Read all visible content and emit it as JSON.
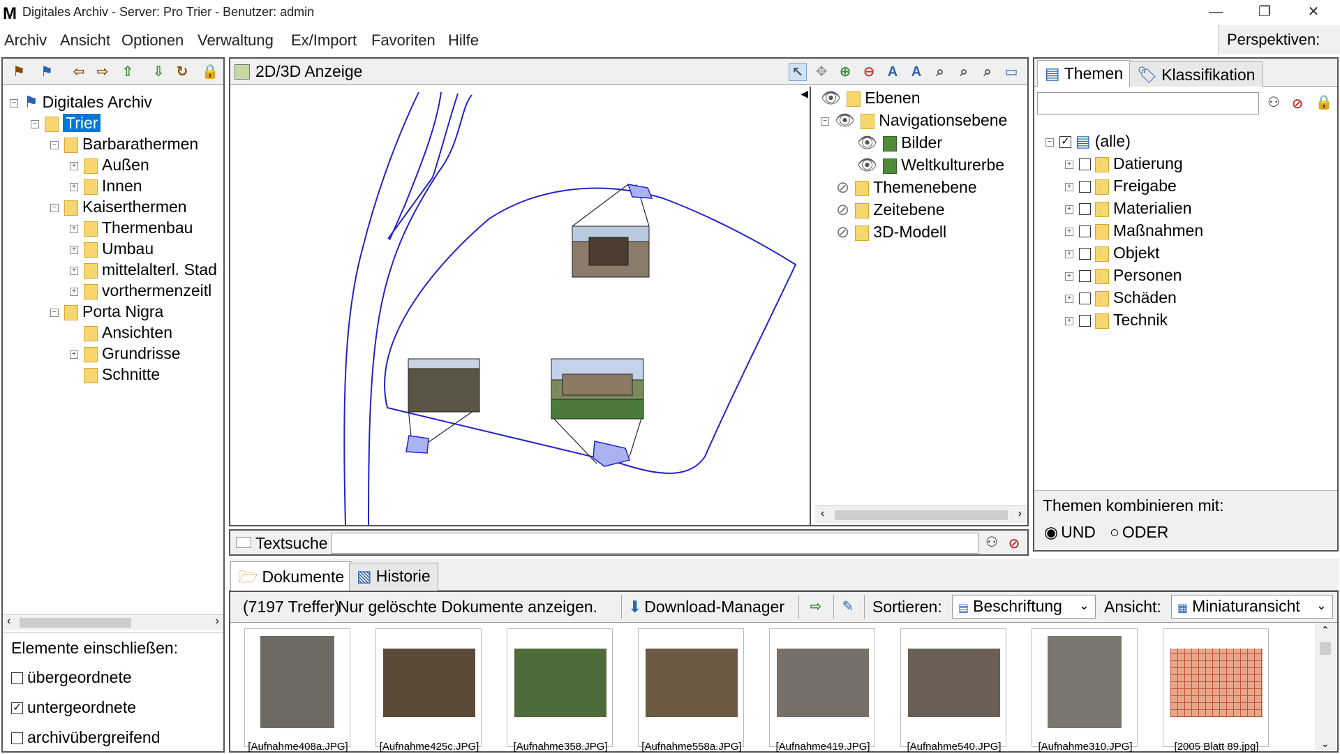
{
  "window": {
    "title": "Digitales Archiv - Server: Pro Trier - Benutzer: admin",
    "app_icon": "M",
    "min_icon": "minimize-icon",
    "restore_icon": "restore-icon",
    "close_icon": "close-icon"
  },
  "menu": {
    "items": [
      "Archiv",
      "Ansicht",
      "Optionen",
      "Verwaltung",
      "Ex/Import",
      "Favoriten",
      "Hilfe"
    ],
    "perspektiven": "Perspektiven:"
  },
  "left_tree": {
    "root": "Digitales Archiv",
    "nodes": [
      {
        "label": "Trier"
      },
      {
        "label": "Barbarathermen"
      },
      {
        "label": "Außen"
      },
      {
        "label": "Innen"
      },
      {
        "label": "Kaiserthermen"
      },
      {
        "label": "Thermenbau"
      },
      {
        "label": "Umbau"
      },
      {
        "label": "mittelalterl. Stad"
      },
      {
        "label": "vorthermenzeitl"
      },
      {
        "label": "Porta Nigra"
      },
      {
        "label": "Ansichten"
      },
      {
        "label": "Grundrisse"
      },
      {
        "label": "Schnitte"
      }
    ],
    "include_title": "Elemente einschließen:",
    "include_options": [
      {
        "label": "übergeordnete",
        "checked": false
      },
      {
        "label": "untergeordnete",
        "checked": true
      },
      {
        "label": "archivübergreifend",
        "checked": false
      }
    ]
  },
  "viewer": {
    "title": "2D/3D Anzeige",
    "layers": {
      "ebenen": "Ebenen",
      "navigation": "Navigationsebene",
      "bilder": "Bilder",
      "welt": "Weltkulturerbe",
      "themen": "Themenebene",
      "zeit": "Zeitebene",
      "modell": "3D-Modell"
    }
  },
  "themes": {
    "tab_themen": "Themen",
    "tab_klass": "Klassifikation",
    "root": "(alle)",
    "items": [
      "Datierung",
      "Freigabe",
      "Materialien",
      "Maßnahmen",
      "Objekt",
      "Personen",
      "Schäden",
      "Technik"
    ],
    "combine_label": "Themen kombinieren mit:",
    "und": "UND",
    "oder": "ODER"
  },
  "textsearch": {
    "label": "Textsuche"
  },
  "docs": {
    "tab_docs": "Dokumente",
    "tab_hist": "Historie",
    "hits": "(7197 Treffer)",
    "deleted": "Nur gelöschte Dokumente anzeigen.",
    "download": "Download-Manager",
    "sort_label": "Sortieren:",
    "sort_value": "Beschriftung",
    "view_label": "Ansicht:",
    "view_value": "Miniaturansicht",
    "thumbnails": [
      {
        "caption": "[Aufnahme408a.JPG]",
        "color": "#6d6a63"
      },
      {
        "caption": "[Aufnahme425c.JPG]",
        "color": "#5a4a38"
      },
      {
        "caption": "[Aufnahme358.JPG]",
        "color": "#4f6b3a"
      },
      {
        "caption": "[Aufnahme558a.JPG]",
        "color": "#6b5a44"
      },
      {
        "caption": "[Aufnahme419.JPG]",
        "color": "#77706a"
      },
      {
        "caption": "[Aufnahme540.JPG]",
        "color": "#6a5f55"
      },
      {
        "caption": "[Aufnahme310.JPG]",
        "color": "#7a7670"
      },
      {
        "caption": "[2005 Blatt 89.jpg]",
        "color": "#e6a88a"
      }
    ]
  }
}
